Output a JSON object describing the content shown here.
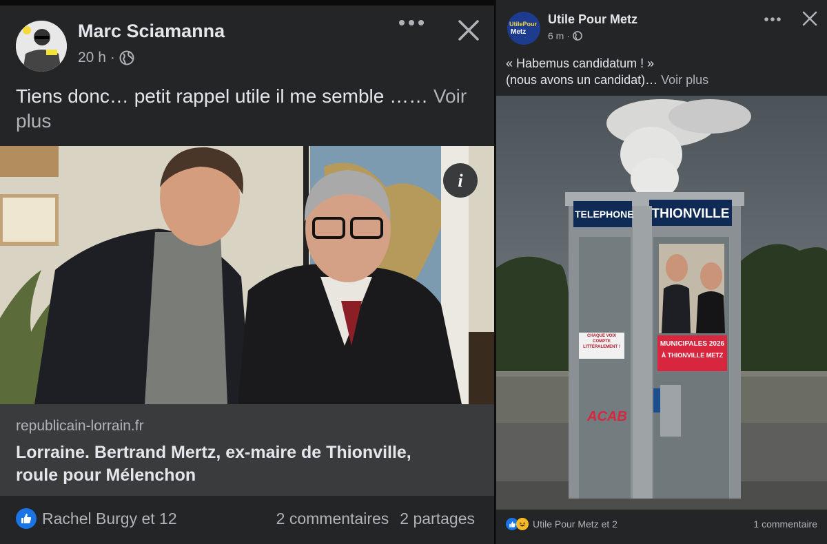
{
  "left_post": {
    "author": "Marc Sciamanna",
    "time": "20 h",
    "text": "Tiens donc… petit rappel utile il me semble …… ",
    "see_more": "Voir plus",
    "more_icon": "ellipsis-horizontal-icon",
    "close_icon": "close-x-icon",
    "privacy_icon": "globe-icon",
    "link": {
      "domain": "republicain-lorrain.fr",
      "title": "Lorraine. Bertrand Mertz, ex-maire de Thionville, roule pour Mélenchon"
    },
    "reactions": "Rachel Burgy et 12",
    "comments": "2 commentaires",
    "shares": "2 partages"
  },
  "right_post": {
    "author": "Utile Pour Metz",
    "avatar_text_line1": "UtilePour",
    "avatar_text_line2": "Metz",
    "time": "6 m",
    "text_line1": "« Habemus candidatum ! »",
    "text_line2": "(nous avons un candidat)… ",
    "see_more": "Voir plus",
    "image": {
      "booth_sign_left": "TELEPHONE",
      "booth_sign_right": "THIONVILLE",
      "small_poster": "CHAQUE VOIX COMPTE LITTÉRALEMENT !",
      "big_poster_line1": "MUNICIPALES 2026",
      "big_poster_line2": "À THIONVILLE METZ",
      "graffiti": "ACAB"
    },
    "reactions": "Utile Pour Metz et 2",
    "comments": "1 commentaire"
  },
  "colors": {
    "bg": "#242526",
    "text": "#e4e6eb",
    "secondary": "#b0b3b8",
    "like_blue": "#1b74e4",
    "haha_yellow": "#f7b928",
    "poster_red": "#d7263d"
  }
}
